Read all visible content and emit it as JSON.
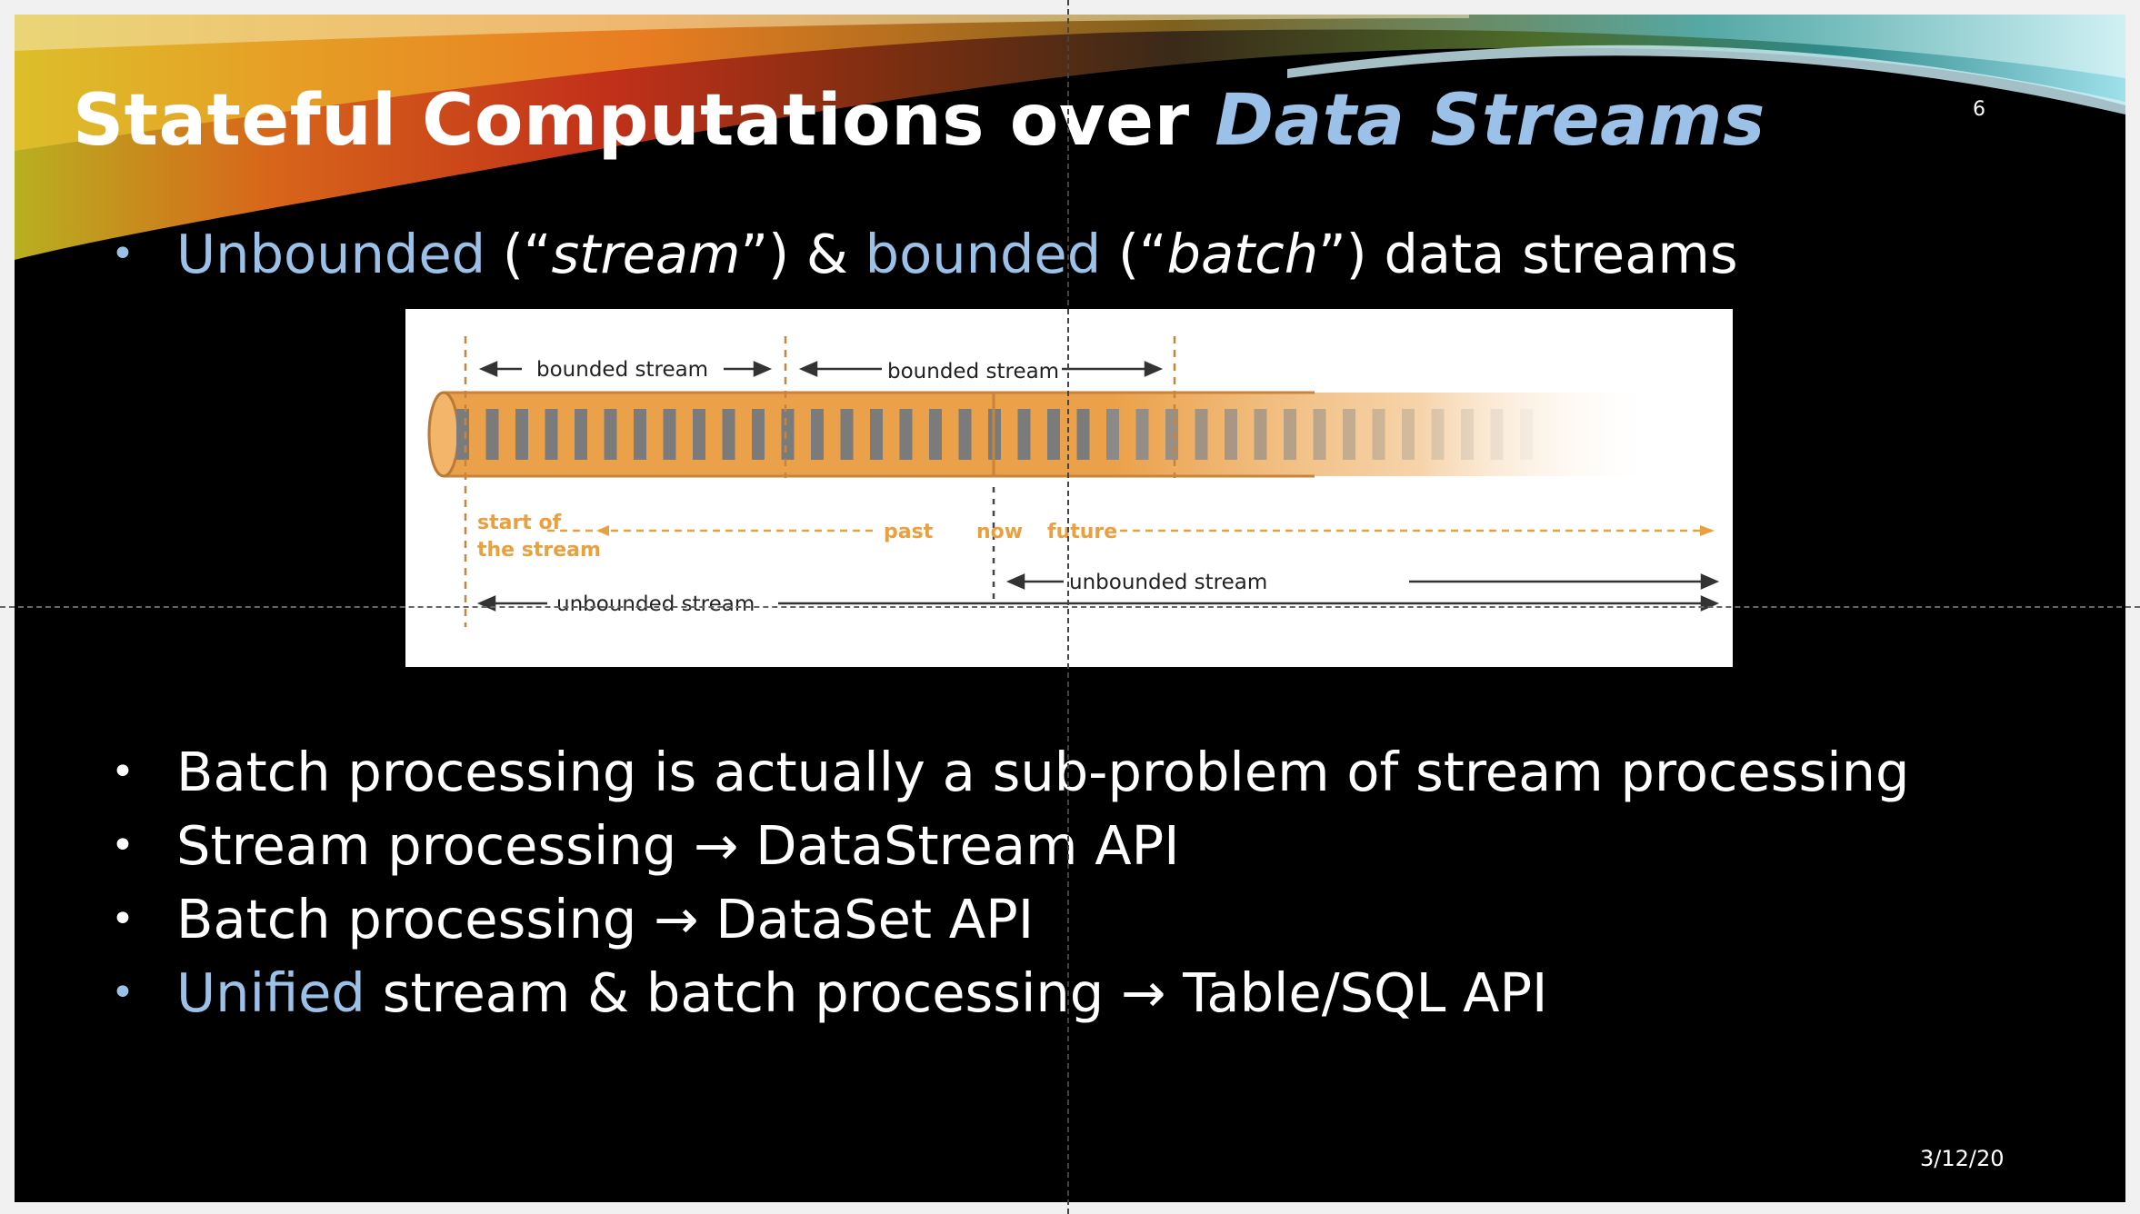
{
  "slide": {
    "title_part1": "Stateful Computations over ",
    "title_part2": "Data Streams",
    "page_number": "6",
    "date": "3/12/20"
  },
  "bullets": [
    {
      "a": "Unbounded",
      "b": " (“",
      "c": "stream",
      "d": "”) & ",
      "e": "bounded",
      "f": " (“",
      "g": "batch",
      "h": "”) data streams"
    },
    {
      "text": "Batch processing is actually a sub-problem of stream processing"
    },
    {
      "text": "Stream processing → DataStream API"
    },
    {
      "text": "Batch processing → DataSet API"
    },
    {
      "a": "Unified",
      "b": " stream & batch processing → Table/SQL API"
    }
  ],
  "diagram": {
    "bounded_label_1": "bounded stream",
    "bounded_label_2": "bounded stream",
    "start_line1": "start of",
    "start_line2": "the stream",
    "past": "past",
    "now": "now",
    "future": "future",
    "unbounded_label_1": "unbounded stream",
    "unbounded_label_2": "unbounded stream",
    "colors": {
      "orange": "#eba14a",
      "bar": "#7b7b7b",
      "label_orange": "#e8a040"
    }
  }
}
